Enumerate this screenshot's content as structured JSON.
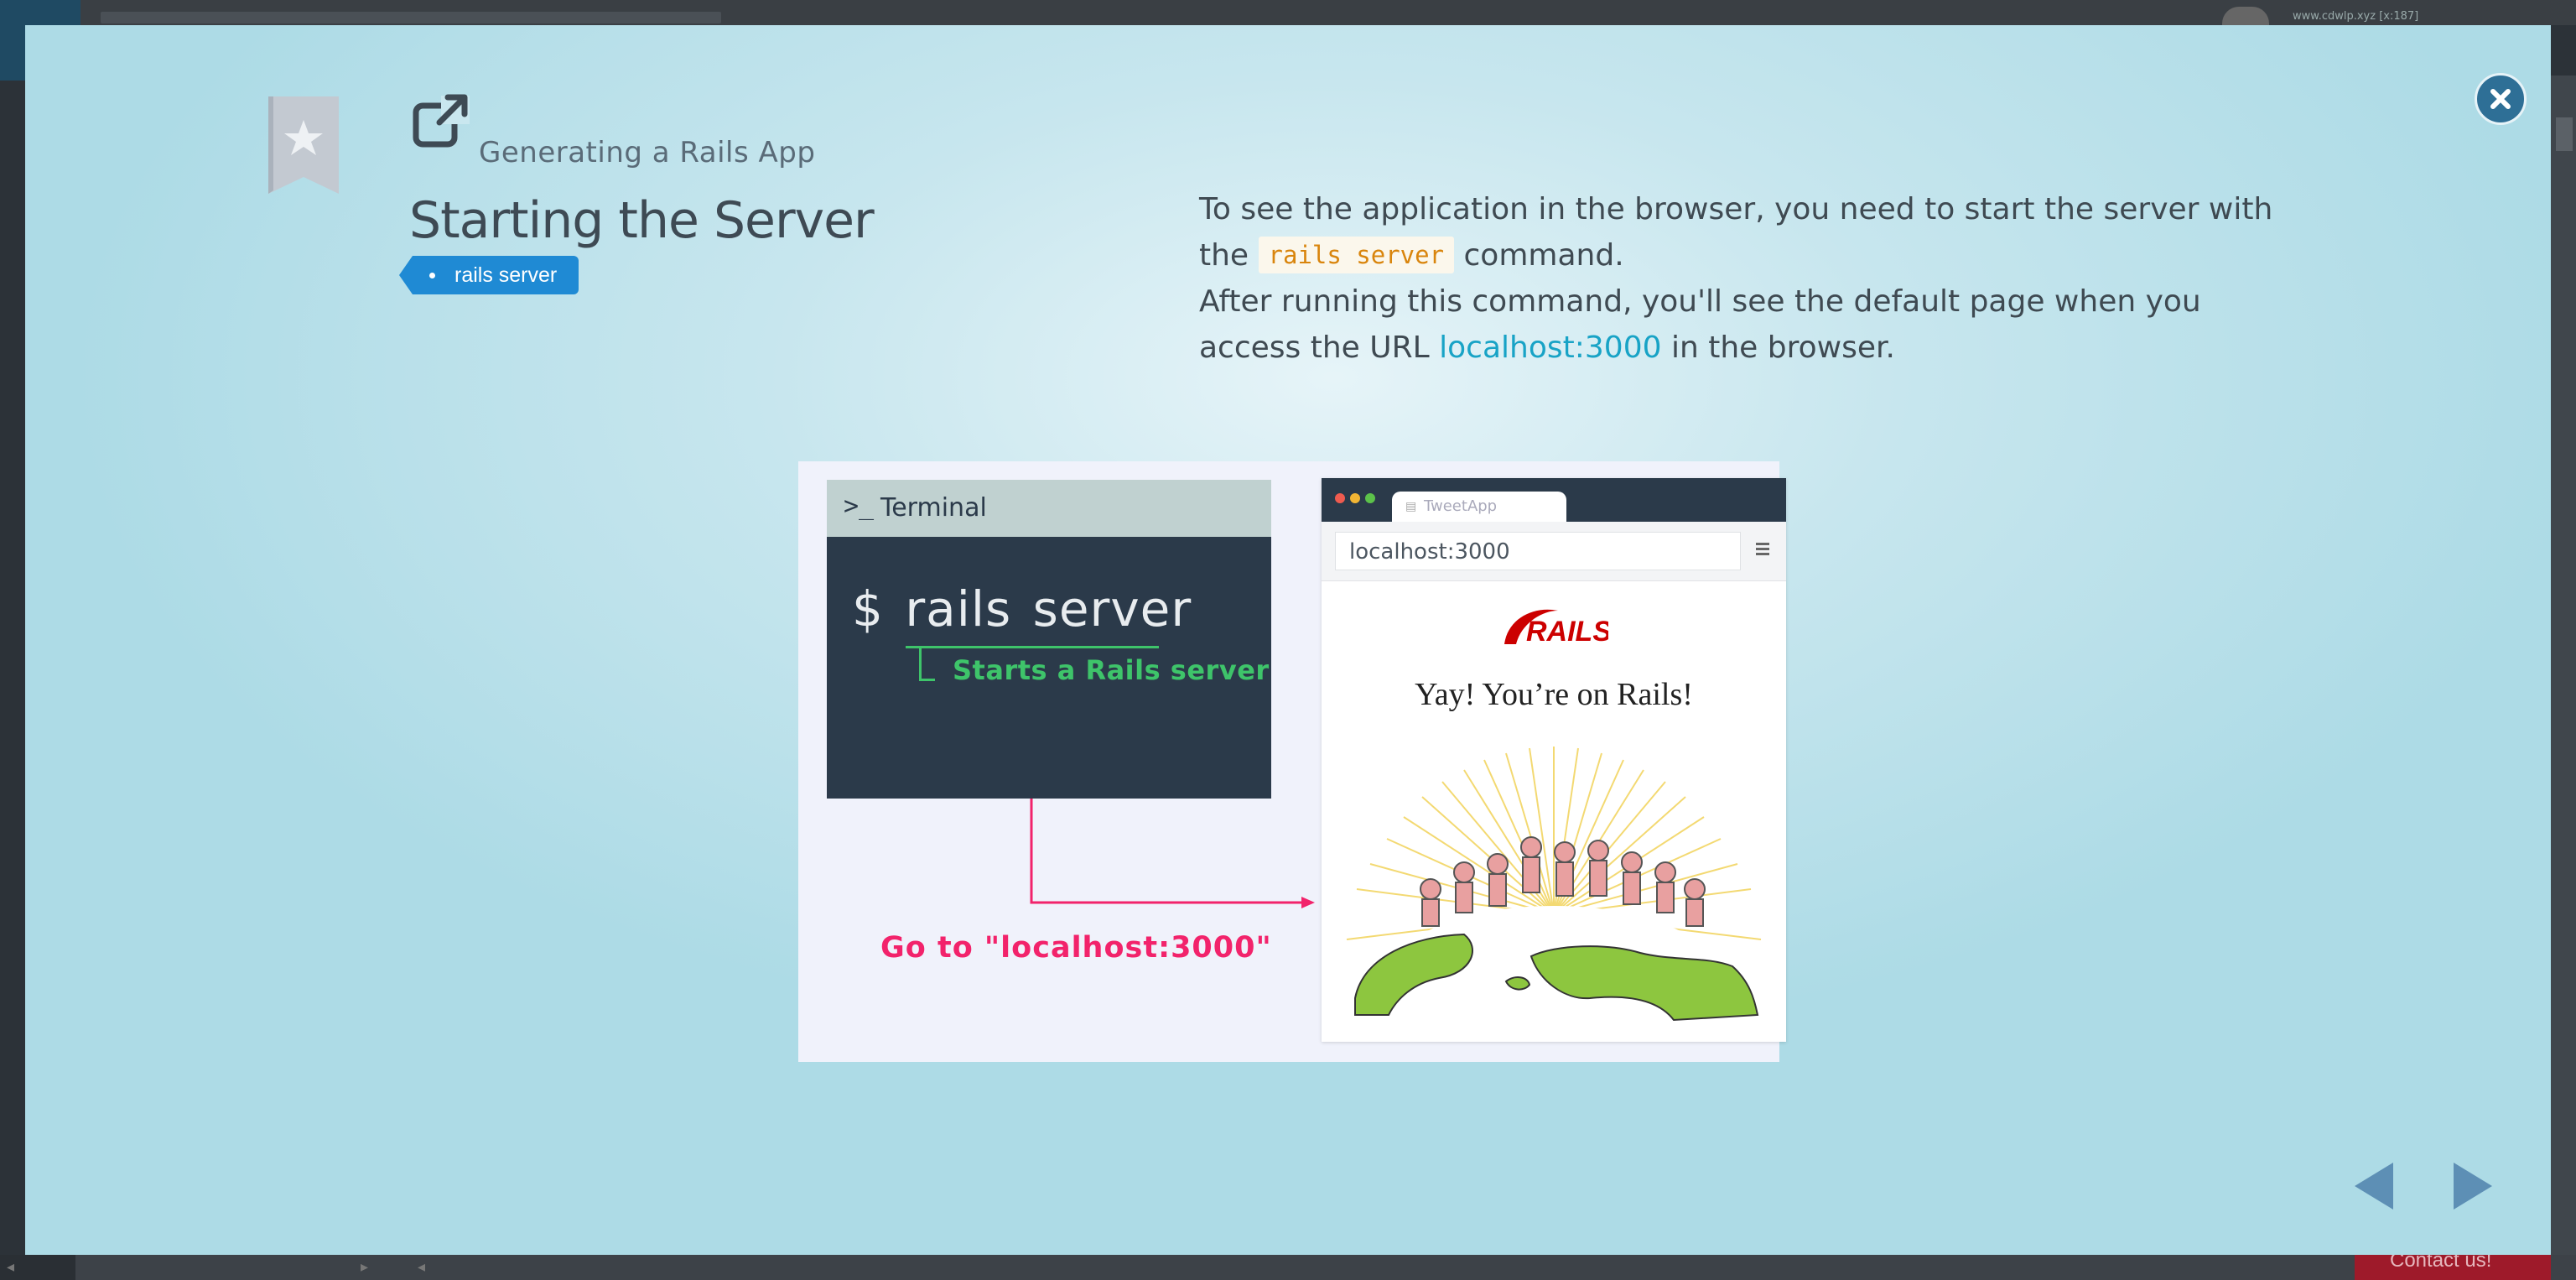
{
  "background": {
    "url_text": "www.cdwlp.xyz [x:187]",
    "contact_label": "Contact us!"
  },
  "lesson": {
    "chapter": "Generating a Rails App",
    "title": "Starting the Server",
    "tag": "rails server",
    "description": {
      "line1_prefix": "To see the application in the browser, you need to start the server with the",
      "code": "rails server",
      "line1_suffix": "command.",
      "line2_prefix": "After running this command, you'll see the default page when you access the URL",
      "link": "localhost:3000",
      "line2_suffix": "in the browser."
    }
  },
  "illustration": {
    "terminal_title": "Terminal",
    "terminal_prompt_icon": ">_",
    "command": "$ rails server",
    "note": "Starts a Rails server",
    "goto": "Go to \"localhost:3000\"",
    "browser_tab": "TweetApp",
    "browser_url": "localhost:3000",
    "rails_logo": "RAILS",
    "yay": "Yay! You’re on Rails!"
  },
  "colors": {
    "accent": "#1f8ad4",
    "close": "#2e6f96",
    "link": "#18a3c6",
    "code": "#d9850d",
    "terminal_green": "#3ec46a",
    "goto_pink": "#f2236b"
  },
  "icons": [
    "bookmark-star-icon",
    "external-link-icon",
    "close-icon",
    "prev-arrow-icon",
    "next-arrow-icon",
    "menu-icon"
  ]
}
